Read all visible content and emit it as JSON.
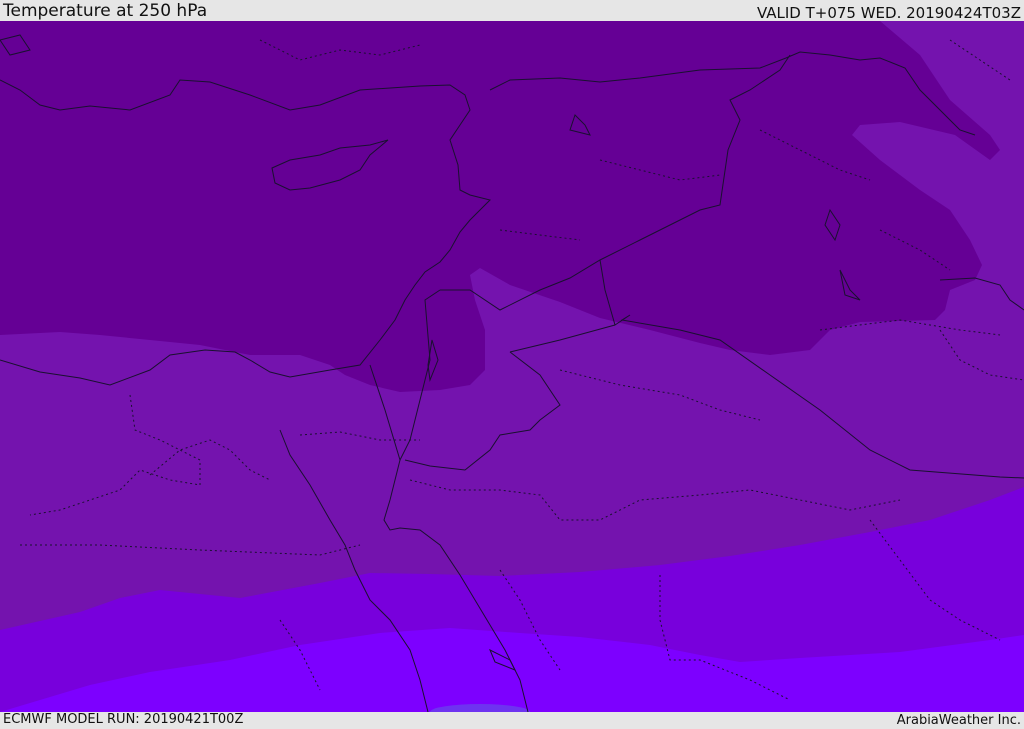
{
  "header": {
    "title": "Temperature at 250 hPa",
    "valid": "VALID T+075 WED. 20190424T03Z"
  },
  "footer": {
    "model_run": "ECMWF MODEL RUN: 20190421T00Z",
    "credit": "ArabiaWeather Inc."
  },
  "map": {
    "variable": "temperature",
    "level": "250 hPa",
    "colors": {
      "darkest": "#650095",
      "dark": "#7413ae",
      "mid": "#7800dc",
      "light": "#7d00ff",
      "blue_spot": "#6e33f0"
    }
  }
}
